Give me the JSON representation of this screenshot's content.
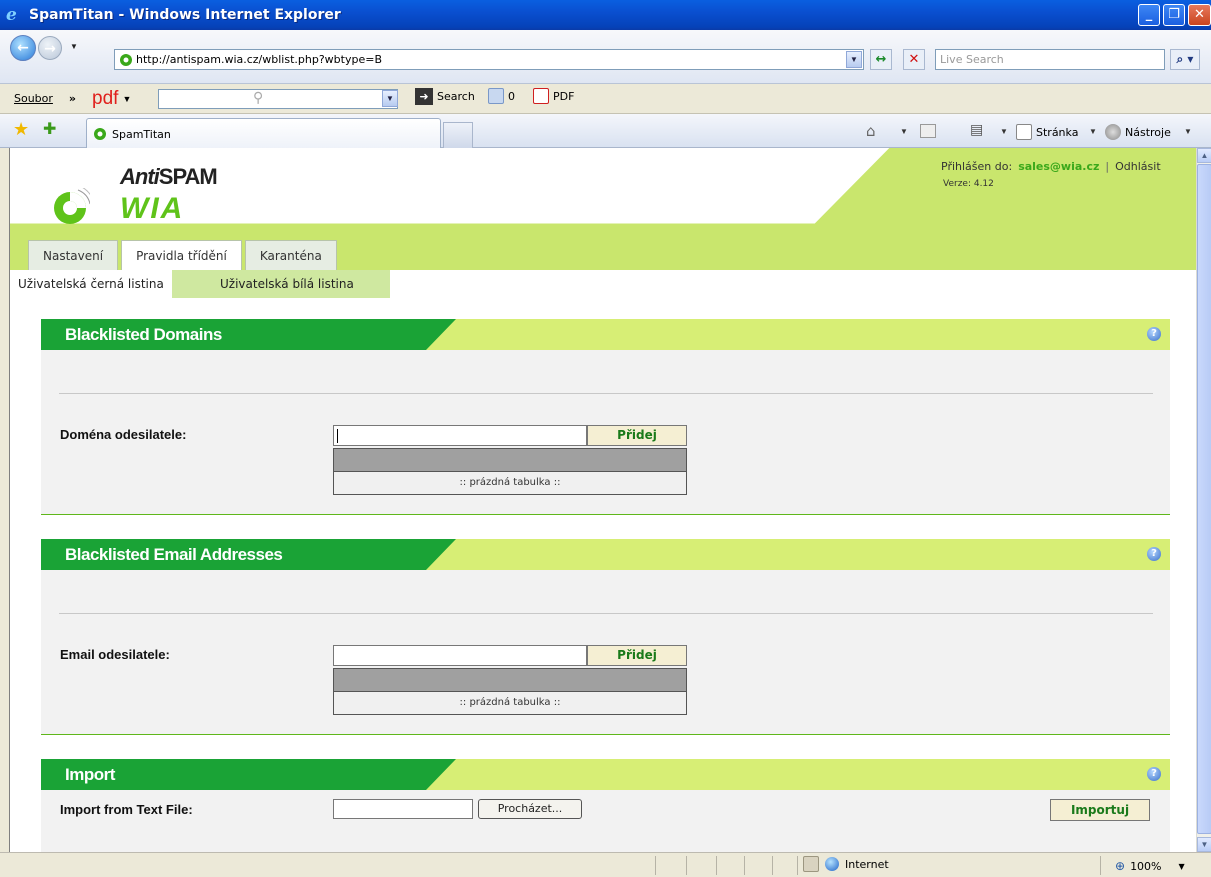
{
  "window": {
    "title": "SpamTitan - Windows Internet Explorer",
    "min": "_",
    "max": "❐",
    "close": "✕"
  },
  "address": {
    "url": "http://antispam.wia.cz/wblist.php?wbtype=B",
    "live_search_placeholder": "Live Search"
  },
  "menubar": {
    "file": "Soubor",
    "more": "»",
    "pdf_logo": "pdf",
    "search": "Search",
    "mail_count": "0",
    "pdf": "PDF"
  },
  "tabbar": {
    "tab_title": "SpamTitan",
    "page": "Stránka",
    "tools": "Nástroje"
  },
  "page": {
    "logo_anti": "Anti",
    "logo_spam": "SPAM",
    "logo_wia": "WIA",
    "logged_in_label": "Přihlášen do:",
    "user_email": "sales@wia.cz",
    "separator": "|",
    "logout": "Odhlásit",
    "version": "Verze: 4.12",
    "main_tabs": [
      {
        "label": "Nastavení"
      },
      {
        "label": "Pravidla třídění"
      },
      {
        "label": "Karanténa"
      }
    ],
    "sub_tabs": [
      {
        "label": "Uživatelská černá listina"
      },
      {
        "label": "Uživatelská bílá listina"
      }
    ]
  },
  "panels": {
    "domains": {
      "title": "Blacklisted Domains",
      "field_label": "Doména odesilatele:",
      "add_label": "Přidej",
      "empty": ":: prázdná tabulka ::"
    },
    "emails": {
      "title": "Blacklisted Email Addresses",
      "field_label": "Email odesilatele:",
      "add_label": "Přidej",
      "empty": ":: prázdná tabulka ::"
    },
    "import": {
      "title": "Import",
      "field_label": "Import from Text File:",
      "browse_label": "Procházet...",
      "import_label": "Importuj"
    },
    "help_glyph": "?"
  },
  "statusbar": {
    "zone": "Internet",
    "zoom": "100%"
  },
  "colors": {
    "brand_green": "#1aa336",
    "header_lime": "#d7ee75",
    "accent_link": "#3aa81a"
  }
}
